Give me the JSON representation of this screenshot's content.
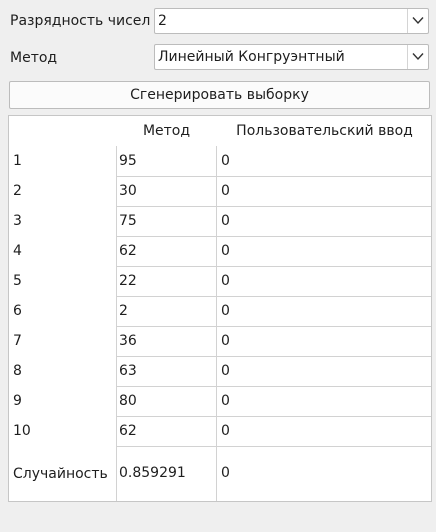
{
  "controls": {
    "digits_label": "Разрядность чисел",
    "digits_value": "2",
    "method_label": "Метод",
    "method_value": "Линейный Конгруэнтный",
    "generate_button": "Сгенерировать выборку"
  },
  "table": {
    "col_method": "Метод",
    "col_user": "Пользовательский ввод",
    "rows": [
      {
        "label": "1",
        "method": "95",
        "user": "0"
      },
      {
        "label": "2",
        "method": "30",
        "user": "0"
      },
      {
        "label": "3",
        "method": "75",
        "user": "0"
      },
      {
        "label": "4",
        "method": "62",
        "user": "0"
      },
      {
        "label": "5",
        "method": "22",
        "user": "0"
      },
      {
        "label": "6",
        "method": "2",
        "user": "0"
      },
      {
        "label": "7",
        "method": "36",
        "user": "0"
      },
      {
        "label": "8",
        "method": "63",
        "user": "0"
      },
      {
        "label": "9",
        "method": "80",
        "user": "0"
      },
      {
        "label": "10",
        "method": "62",
        "user": "0"
      }
    ],
    "randomness": {
      "label": "Случайность",
      "method": "0.859291",
      "user": "0"
    }
  }
}
